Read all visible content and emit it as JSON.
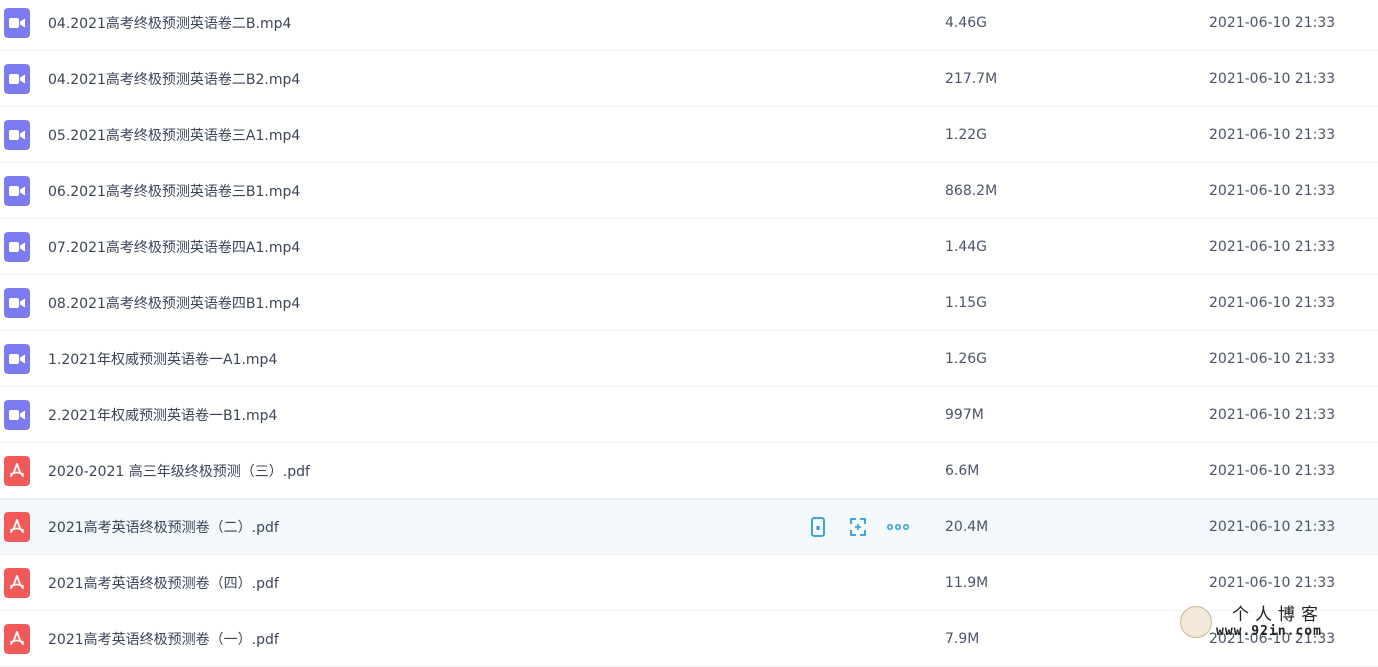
{
  "colors": {
    "video_icon": "#7c7bf0",
    "pdf_icon": "#f25a5a",
    "action_icon": "#2d9bd7",
    "hover_row": "#f4f9fd"
  },
  "files": [
    {
      "type": "video",
      "icon": "video-icon",
      "name": "04.2021高考终极预测英语卷二B.mp4",
      "size": "4.46G",
      "time": "2021-06-10 21:33"
    },
    {
      "type": "video",
      "icon": "video-icon",
      "name": "04.2021高考终极预测英语卷二B2.mp4",
      "size": "217.7M",
      "time": "2021-06-10 21:33"
    },
    {
      "type": "video",
      "icon": "video-icon",
      "name": "05.2021高考终极预测英语卷三A1.mp4",
      "size": "1.22G",
      "time": "2021-06-10 21:33"
    },
    {
      "type": "video",
      "icon": "video-icon",
      "name": "06.2021高考终极预测英语卷三B1.mp4",
      "size": "868.2M",
      "time": "2021-06-10 21:33"
    },
    {
      "type": "video",
      "icon": "video-icon",
      "name": "07.2021高考终极预测英语卷四A1.mp4",
      "size": "1.44G",
      "time": "2021-06-10 21:33"
    },
    {
      "type": "video",
      "icon": "video-icon",
      "name": "08.2021高考终极预测英语卷四B1.mp4",
      "size": "1.15G",
      "time": "2021-06-10 21:33"
    },
    {
      "type": "video",
      "icon": "video-icon",
      "name": "1.2021年权威预测英语卷一A1.mp4",
      "size": "1.26G",
      "time": "2021-06-10 21:33"
    },
    {
      "type": "video",
      "icon": "video-icon",
      "name": "2.2021年权威预测英语卷一B1.mp4",
      "size": "997M",
      "time": "2021-06-10 21:33"
    },
    {
      "type": "pdf",
      "icon": "pdf-icon",
      "name": "2020-2021 高三年级终极预测（三）.pdf",
      "size": "6.6M",
      "time": "2021-06-10 21:33"
    },
    {
      "type": "pdf",
      "icon": "pdf-icon",
      "name": "2021高考英语终极预测卷（二）.pdf",
      "size": "20.4M",
      "time": "2021-06-10 21:33",
      "hover": true
    },
    {
      "type": "pdf",
      "icon": "pdf-icon",
      "name": "2021高考英语终极预测卷（四）.pdf",
      "size": "11.9M",
      "time": "2021-06-10 21:33"
    },
    {
      "type": "pdf",
      "icon": "pdf-icon",
      "name": "2021高考英语终极预测卷（一）.pdf",
      "size": "7.9M",
      "time": "2021-06-10 21:33"
    }
  ],
  "row_actions": [
    {
      "icon": "phone-icon"
    },
    {
      "icon": "share-icon"
    },
    {
      "icon": "more-icon"
    }
  ],
  "watermark": {
    "title": "个人博客",
    "url": "www.92in.com"
  }
}
